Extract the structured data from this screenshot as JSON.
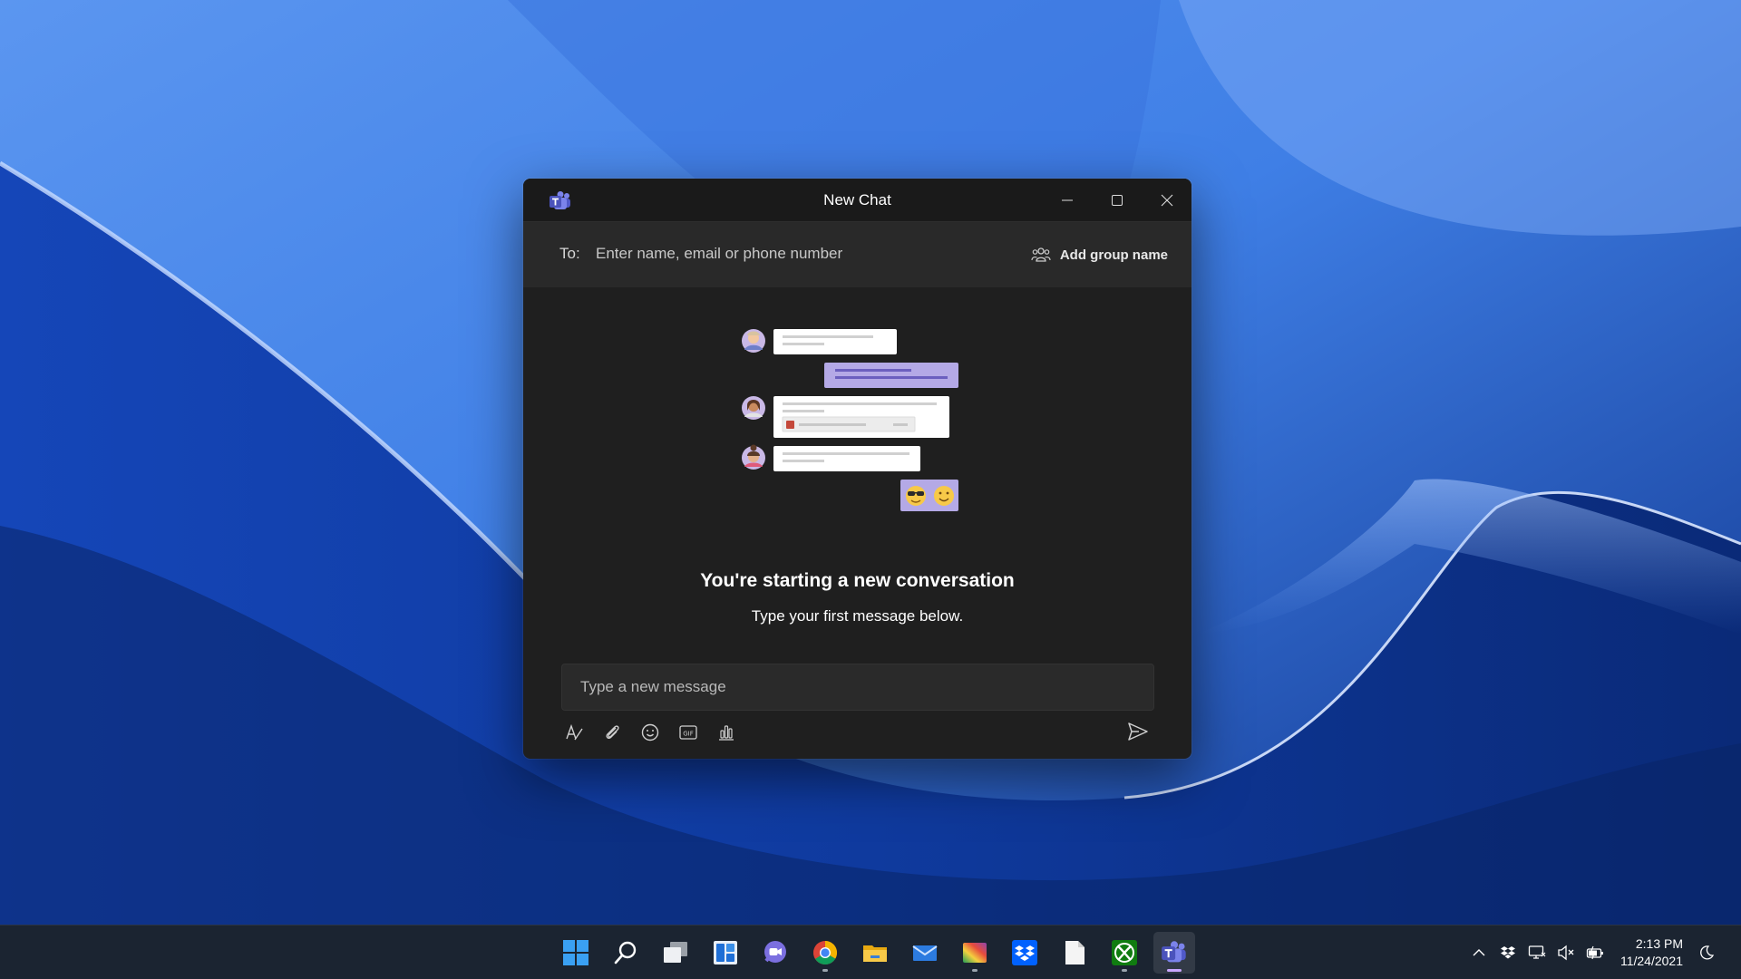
{
  "window": {
    "title": "New Chat",
    "accent": "#7b83eb"
  },
  "to_bar": {
    "label": "To:",
    "placeholder": "Enter name, email or phone number",
    "group_button_label": "Add group name"
  },
  "empty_state": {
    "headline": "You're starting a new conversation",
    "subline": "Type your first message below."
  },
  "compose": {
    "placeholder": "Type a new message",
    "tools": [
      "format-icon",
      "attach-icon",
      "emoji-icon",
      "gif-icon",
      "poll-icon"
    ],
    "send_icon": "send-icon"
  },
  "taskbar": {
    "apps": [
      {
        "name": "start-icon",
        "running": false
      },
      {
        "name": "search-icon",
        "running": false
      },
      {
        "name": "task-view-icon",
        "running": false
      },
      {
        "name": "widgets-icon",
        "running": false
      },
      {
        "name": "chat-icon",
        "running": false
      },
      {
        "name": "chrome-icon",
        "running": true
      },
      {
        "name": "file-explorer-icon",
        "running": false
      },
      {
        "name": "mail-icon",
        "running": false
      },
      {
        "name": "photos-icon",
        "running": true
      },
      {
        "name": "dropbox-icon",
        "running": false
      },
      {
        "name": "notepad-icon",
        "running": false
      },
      {
        "name": "xbox-icon",
        "running": true
      },
      {
        "name": "teams-icon",
        "running": true,
        "active": true
      }
    ],
    "tray": [
      "chevron-up-icon",
      "dropbox-tray-icon",
      "network-icon",
      "volume-muted-icon",
      "battery-icon"
    ],
    "time": "2:13 PM",
    "date": "11/24/2021",
    "notification_icon": "moon-icon"
  }
}
